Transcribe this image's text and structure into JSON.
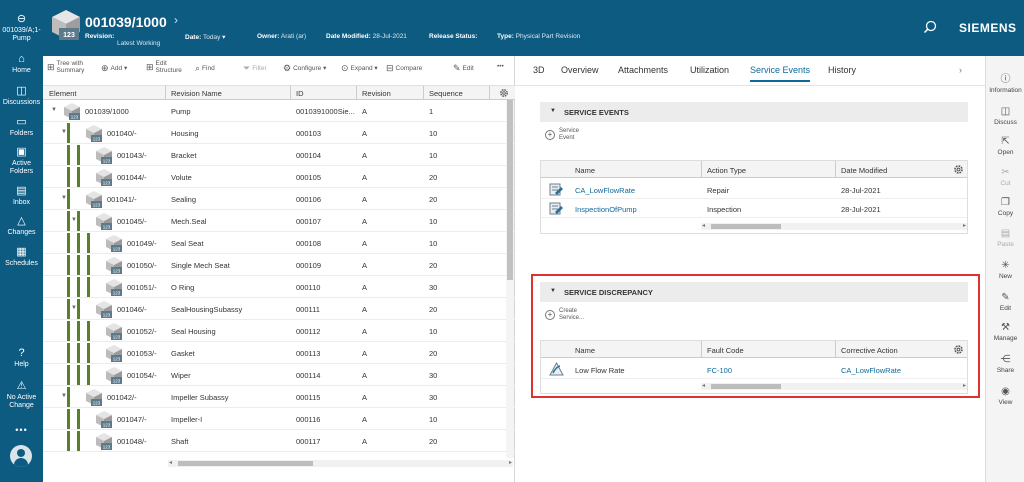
{
  "nav": {
    "back_label_1": "001039/A;1-",
    "back_label_2": "Pump",
    "items": [
      {
        "label": "Home",
        "icon": "home-icon"
      },
      {
        "label": "Discussions",
        "icon": "discussions-icon"
      },
      {
        "label": "Folders",
        "icon": "folder-icon"
      },
      {
        "label": "Active Folders",
        "icon": "active-folders-icon"
      },
      {
        "label": "Inbox",
        "icon": "inbox-icon"
      },
      {
        "label": "Changes",
        "icon": "changes-icon"
      },
      {
        "label": "Schedules",
        "icon": "schedules-icon"
      },
      {
        "label": "Help",
        "icon": "help-icon"
      },
      {
        "label": "No Active Change",
        "icon": "change-icon"
      }
    ],
    "more": "•••"
  },
  "header": {
    "title": "001039/1000",
    "revision_label": "Revision:",
    "revision_value": "Latest Working",
    "date_label": "Date:",
    "date_value": "Today",
    "owner_label": "Owner:",
    "owner_value": "Arati (ar)",
    "modified_label": "Date Modified:",
    "modified_value": "28-Jul-2021",
    "release_label": "Release Status:",
    "release_value": "",
    "type_label": "Type:",
    "type_value": "Physical Part Revision",
    "brand": "SIEMENS"
  },
  "toolbar": {
    "tree_with_summary": "Tree with Summary",
    "add": "Add",
    "edit_structure": "Edit Structure",
    "find": "Find",
    "filter": "Filter",
    "configure": "Configure",
    "expand": "Expand",
    "compare": "Compare",
    "edit": "Edit",
    "more": "•••"
  },
  "tree": {
    "columns": [
      "Element",
      "Revision Name",
      "ID",
      "Revision",
      "Sequence"
    ],
    "rows": [
      {
        "element": "001039/1000",
        "name": "Pump",
        "id": "0010391000Sie...",
        "rev": "A",
        "seq": "1"
      },
      {
        "element": "001040/-",
        "name": "Housing",
        "id": "000103",
        "rev": "A",
        "seq": "10"
      },
      {
        "element": "001043/-",
        "name": "Bracket",
        "id": "000104",
        "rev": "A",
        "seq": "10"
      },
      {
        "element": "001044/-",
        "name": "Volute",
        "id": "000105",
        "rev": "A",
        "seq": "20"
      },
      {
        "element": "001041/-",
        "name": "Sealing",
        "id": "000106",
        "rev": "A",
        "seq": "20"
      },
      {
        "element": "001045/-",
        "name": "Mech.Seal",
        "id": "000107",
        "rev": "A",
        "seq": "10"
      },
      {
        "element": "001049/-",
        "name": "Seal Seat",
        "id": "000108",
        "rev": "A",
        "seq": "10"
      },
      {
        "element": "001050/-",
        "name": "Single Mech Seat",
        "id": "000109",
        "rev": "A",
        "seq": "20"
      },
      {
        "element": "001051/-",
        "name": "O Ring",
        "id": "000110",
        "rev": "A",
        "seq": "30"
      },
      {
        "element": "001046/-",
        "name": "SealHousingSubassy",
        "id": "000111",
        "rev": "A",
        "seq": "20"
      },
      {
        "element": "001052/-",
        "name": "Seal Housing",
        "id": "000112",
        "rev": "A",
        "seq": "10"
      },
      {
        "element": "001053/-",
        "name": "Gasket",
        "id": "000113",
        "rev": "A",
        "seq": "20"
      },
      {
        "element": "001054/-",
        "name": "Wiper",
        "id": "000114",
        "rev": "A",
        "seq": "30"
      },
      {
        "element": "001042/-",
        "name": "Impeller Subassy",
        "id": "000115",
        "rev": "A",
        "seq": "30"
      },
      {
        "element": "001047/-",
        "name": "Impeller-I",
        "id": "000116",
        "rev": "A",
        "seq": "10"
      },
      {
        "element": "001048/-",
        "name": "Shaft",
        "id": "000117",
        "rev": "A",
        "seq": "20"
      }
    ]
  },
  "tabs": [
    "3D",
    "Overview",
    "Attachments",
    "Utilization",
    "Service Events",
    "History"
  ],
  "active_tab": "Service Events",
  "service_events": {
    "title": "SERVICE EVENTS",
    "add_label_1": "Service",
    "add_label_2": "Event",
    "columns": [
      "Name",
      "Action Type",
      "Date Modified"
    ],
    "rows": [
      {
        "name": "CA_LowFlowRate",
        "action": "Repair",
        "date": "28-Jul-2021"
      },
      {
        "name": "InspectionOfPump",
        "action": "Inspection",
        "date": "28-Jul-2021"
      }
    ]
  },
  "service_discrepancy": {
    "title": "SERVICE DISCREPANCY",
    "add_label_1": "Create",
    "add_label_2": "Service...",
    "columns": [
      "Name",
      "Fault Code",
      "Corrective Action"
    ],
    "rows": [
      {
        "name": "Low Flow Rate",
        "fault": "FC-100",
        "action": "CA_LowFlowRate"
      }
    ]
  },
  "rail": [
    {
      "label": "Information",
      "icon": "info-icon"
    },
    {
      "label": "Discuss",
      "icon": "discuss-icon"
    },
    {
      "label": "Open",
      "icon": "open-icon"
    },
    {
      "label": "Cut",
      "icon": "cut-icon"
    },
    {
      "label": "Copy",
      "icon": "copy-icon"
    },
    {
      "label": "Paste",
      "icon": "paste-icon"
    },
    {
      "label": "New",
      "icon": "new-icon"
    },
    {
      "label": "Edit",
      "icon": "edit-icon"
    },
    {
      "label": "Manage",
      "icon": "manage-icon"
    },
    {
      "label": "Share",
      "icon": "share-icon"
    },
    {
      "label": "View",
      "icon": "view-icon"
    }
  ],
  "colors": {
    "header": "#0e5b82",
    "accent": "#0e6a9a",
    "tree_bar": "#5a7f2b",
    "highlight": "#e03131"
  }
}
